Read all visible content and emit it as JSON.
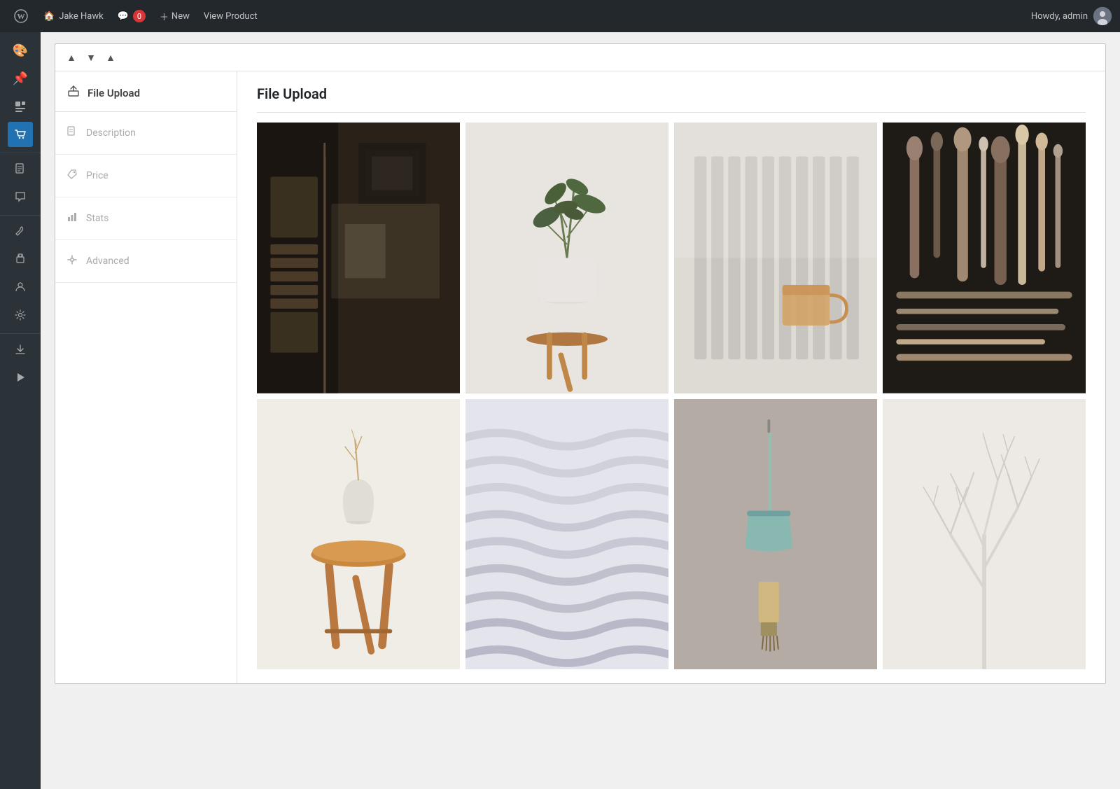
{
  "adminbar": {
    "site_name": "Jake Hawk",
    "comments_label": "Comments",
    "comments_count": "0",
    "new_label": "New",
    "view_product_label": "View Product",
    "howdy_label": "Howdy, admin"
  },
  "sidebar": {
    "icons": [
      {
        "name": "paint-icon",
        "symbol": "🎨",
        "active": false
      },
      {
        "name": "pin-icon",
        "symbol": "📌",
        "active": false
      },
      {
        "name": "posts-icon",
        "symbol": "📋",
        "active": false
      },
      {
        "name": "products-icon",
        "symbol": "🛒",
        "active": true
      },
      {
        "name": "pages-icon",
        "symbol": "📄",
        "active": false
      },
      {
        "name": "comments-sidebar-icon",
        "symbol": "💬",
        "active": false
      },
      {
        "name": "tools-icon",
        "symbol": "🔧",
        "active": false
      },
      {
        "name": "plugins-icon",
        "symbol": "🔌",
        "active": false
      },
      {
        "name": "users-icon",
        "symbol": "👤",
        "active": false
      },
      {
        "name": "settings-icon",
        "symbol": "⚙",
        "active": false
      },
      {
        "name": "import-icon",
        "symbol": "⬇",
        "active": false
      },
      {
        "name": "play-icon",
        "symbol": "▶",
        "active": false
      }
    ]
  },
  "panel": {
    "collapse_up_label": "▲",
    "collapse_down_label": "▼",
    "collapse_alt_label": "▲",
    "header_icon": "⬆",
    "header_label": "File Upload",
    "tabs": [
      {
        "id": "description",
        "icon": "📝",
        "label": "Description"
      },
      {
        "id": "price",
        "icon": "🛒",
        "label": "Price"
      },
      {
        "id": "stats",
        "icon": "📊",
        "label": "Stats"
      },
      {
        "id": "advanced",
        "icon": "➕",
        "label": "Advanced"
      }
    ],
    "active_tab": {
      "title": "File Upload"
    }
  },
  "images": [
    {
      "id": "img1",
      "alt": "Dark room with furniture",
      "style": "img-dark-room"
    },
    {
      "id": "img2",
      "alt": "Plant in white pot",
      "style": "img-plant"
    },
    {
      "id": "img3",
      "alt": "Mug on surface",
      "style": "img-mug"
    },
    {
      "id": "img4",
      "alt": "Collection of wooden spoons",
      "style": "img-spoons"
    },
    {
      "id": "img5",
      "alt": "Vase on wooden stool",
      "style": "img-stool"
    },
    {
      "id": "img6",
      "alt": "Abstract wave lines",
      "style": "img-waves"
    },
    {
      "id": "img7",
      "alt": "Brush and dustpan",
      "style": "img-brush"
    },
    {
      "id": "img8",
      "alt": "White branch",
      "style": "img-branch"
    }
  ]
}
